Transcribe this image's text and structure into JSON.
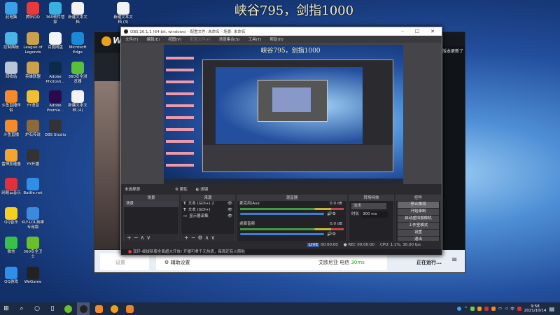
{
  "overlay_title": "峡谷795，剑指1000",
  "desktop_icons": [
    {
      "label": "此电脑",
      "color": "#3aa0e8"
    },
    {
      "label": "控制面板",
      "color": "#4ab3e8"
    },
    {
      "label": "回收站",
      "color": "#b8c6d8"
    },
    {
      "label": "斗鱼直播伴侣",
      "color": "#f58a2a"
    },
    {
      "label": "斗鱼直播",
      "color": "#f58a2a"
    },
    {
      "label": "雷神加速器",
      "color": "#f2a531"
    },
    {
      "label": "网易云音乐",
      "color": "#e0303a"
    },
    {
      "label": "QQ音乐",
      "color": "#f5d020"
    },
    {
      "label": "微信",
      "color": "#39c04a"
    },
    {
      "label": "QQ游戏",
      "color": "#2f8fe6"
    },
    {
      "label": "腾讯QQ",
      "color": "#e83a3a"
    },
    {
      "label": "League of Legends",
      "color": "#c9a24a"
    },
    {
      "label": "英雄联盟",
      "color": "#c9a24a"
    },
    {
      "label": "YY语音",
      "color": "#f0c030"
    },
    {
      "label": "炉石传说",
      "color": "#8a6a3a"
    },
    {
      "label": "YY开播",
      "color": "#333"
    },
    {
      "label": "Battle.net",
      "color": "#2f8fe6"
    },
    {
      "label": "KLY-LOL英雄专用版",
      "color": "#3a8ae0"
    },
    {
      "label": "360安全卫士",
      "color": "#6ac02a"
    },
    {
      "label": "WeGame",
      "color": "#222"
    },
    {
      "label": "360软件管家",
      "color": "#3ab0e0"
    },
    {
      "label": "百度网盘",
      "color": "#f2f5fa"
    },
    {
      "label": "Adobe Photosh...",
      "color": "#0c2a4a"
    },
    {
      "label": "Adobe Premie...",
      "color": "#2a0a4a"
    },
    {
      "label": "OBS Studio",
      "color": "#333"
    },
    {
      "label": "新建文本文档",
      "color": "#f2f2f2"
    },
    {
      "label": "Microsoft Edge",
      "color": "#1a8ad8"
    },
    {
      "label": "360安全浏览器",
      "color": "#5ac03a"
    },
    {
      "label": "新建文本文档 (4)",
      "color": "#f2f2f2"
    },
    {
      "label": "新建文本文档 (3)",
      "color": "#f2f2f2"
    }
  ],
  "wegame": {
    "logo": "WeGame",
    "right_text": "版本更新了",
    "bottom_left": "设置",
    "assist": "辅助设置",
    "server": "艾欧尼亚 电信",
    "ping": "30ms",
    "running": "正在运行..."
  },
  "obs": {
    "title": "OBS 26.1.1 (64-bit, windows) - 配置文件: 未命名 - 场景: 未命名",
    "menu": [
      "文件(F)",
      "编辑(E)",
      "视图(V)",
      "配置文件(P)",
      "场景集合(S)",
      "工具(T)",
      "帮助(H)"
    ],
    "preview_title": "峡谷795，剑指1000",
    "no_source": "未选择源",
    "properties": "属性",
    "filters": "滤镜",
    "docks": {
      "scenes": "场景",
      "sources": "来源",
      "mixer": "混音器",
      "transitions": "转场特效",
      "controls": "控件"
    },
    "scenes": [
      "场景"
    ],
    "sources": [
      "文本 (GDI+) 2",
      "文本 (GDI+)",
      "显示器采集"
    ],
    "mixer": [
      {
        "name": "麦克风/Aux",
        "db": "0.0 dB",
        "level": 0
      },
      {
        "name": "桌面音频",
        "db": "0.0 dB",
        "level": 0
      }
    ],
    "transition": {
      "type": "淡出",
      "duration_label": "时长",
      "duration": "300 ms"
    },
    "controls": [
      "停止推流",
      "开始录制",
      "启动虚拟摄像机",
      "工作室模式",
      "设置",
      "退出"
    ],
    "status": {
      "live_label": "LIVE",
      "live": "00:00:00",
      "rec_label": "REC",
      "rec": "00:00:00",
      "cpu": "CPU: 1.1%, 30.00 fps"
    },
    "notice": "双环-细拔新服全面超大开放! 开播可拿千元热遗，每周还有火箭啦"
  },
  "taskbar": {
    "time": "9:58",
    "date": "2021/10/14"
  }
}
